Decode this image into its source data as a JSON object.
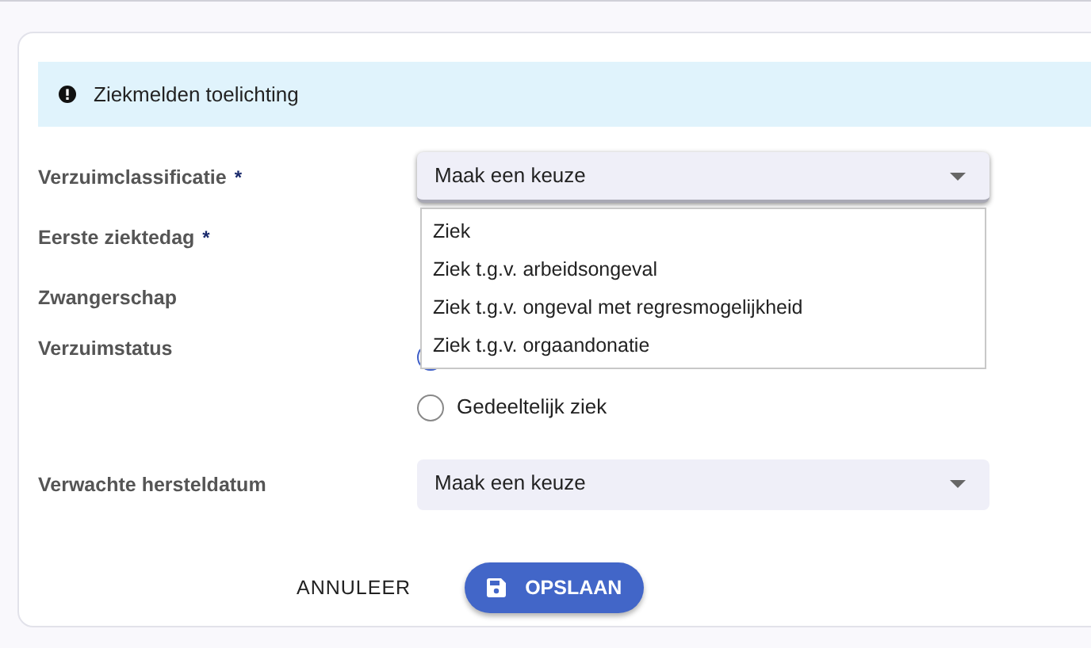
{
  "banner": {
    "text": "Ziekmelden toelichting"
  },
  "fields": [
    {
      "kind": "select",
      "label": "Verzuimclassificatie",
      "required_mark": "*",
      "value": "Maak een keuze",
      "expanded": true,
      "options": [
        "Ziek",
        "Ziek t.g.v. arbeidsongeval",
        "Ziek t.g.v. ongeval met regresmogelijkheid",
        "Ziek t.g.v. orgaandonatie"
      ]
    },
    {
      "kind": "hidden",
      "label": "Eerste ziektedag",
      "required_mark": "*"
    },
    {
      "kind": "hidden",
      "label": "Zwangerschap"
    },
    {
      "kind": "radio",
      "label": "Verzuimstatus",
      "options": [
        {
          "selected": true
        },
        {
          "label": "Gedeeltelijk ziek",
          "selected": false
        }
      ]
    },
    {
      "kind": "select",
      "label": "Verwachte hersteldatum",
      "value": "Maak een keuze",
      "expanded": false
    }
  ],
  "actions": {
    "cancel": "ANNULEER",
    "save": "OPSLAAN"
  }
}
